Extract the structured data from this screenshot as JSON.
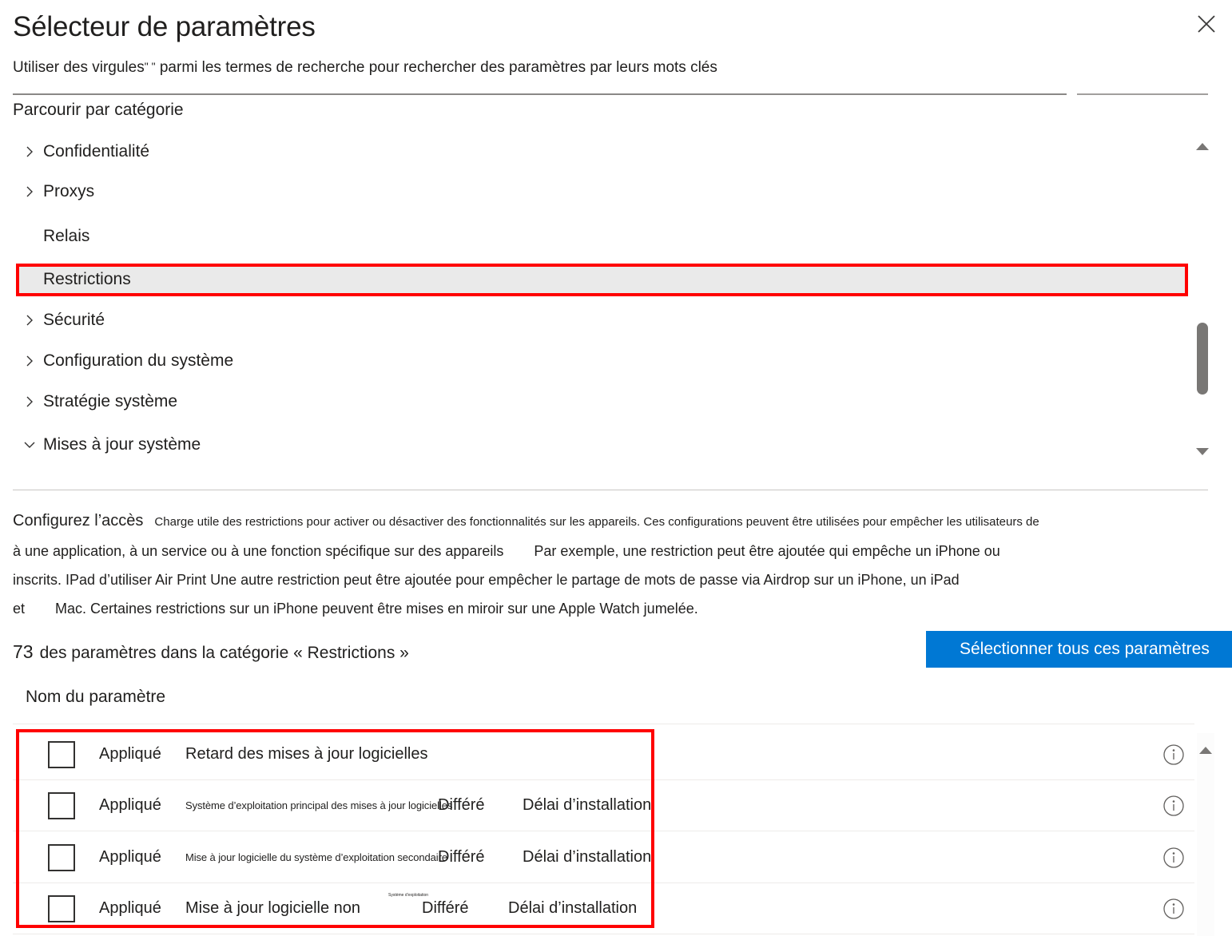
{
  "dialog": {
    "title": "Sélecteur de paramètres",
    "close_label": "Fermer",
    "close_icon": "close-icon"
  },
  "search": {
    "hint_prefix": "Utiliser des virgules",
    "hint_quote": "\" \"",
    "hint_suffix": " parmi les termes de recherche pour rechercher des paramètres par leurs mots clés",
    "value": "",
    "placeholder": ""
  },
  "browse": {
    "label": "Parcourir par catégorie",
    "items": [
      {
        "label": "Confidentialité",
        "expandable": true,
        "expanded": false,
        "selected": false,
        "icon": "chevron-right-icon"
      },
      {
        "label": "Proxys",
        "expandable": true,
        "expanded": false,
        "selected": false,
        "icon": "chevron-right-icon"
      },
      {
        "label": "Relais",
        "expandable": false,
        "expanded": false,
        "selected": false,
        "icon": ""
      },
      {
        "label": "Restrictions",
        "expandable": false,
        "expanded": false,
        "selected": true,
        "icon": ""
      },
      {
        "label": "Sécurité",
        "expandable": true,
        "expanded": false,
        "selected": false,
        "icon": "chevron-right-icon"
      },
      {
        "label": "Configuration du système",
        "expandable": true,
        "expanded": false,
        "selected": false,
        "icon": "chevron-right-icon"
      },
      {
        "label": "Stratégie système",
        "expandable": true,
        "expanded": false,
        "selected": false,
        "icon": "chevron-right-icon"
      },
      {
        "label": "Mises à jour système",
        "expandable": true,
        "expanded": true,
        "selected": false,
        "icon": "chevron-down-icon"
      }
    ],
    "scroll_up_icon": "triangle-up-icon",
    "scroll_down_icon": "triangle-down-icon"
  },
  "description": {
    "line1_a": "Configurez l’accès",
    "line1_b": "Charge utile des restrictions pour activer ou désactiver des fonctionnalités sur les appareils. Ces configurations peuvent être utilisées pour empêcher les utilisateurs de",
    "line2_a": "à une application, à un service ou à une fonction spécifique sur des appareils",
    "line2_b": "Par exemple, une restriction peut être ajoutée qui empêche un iPhone ou",
    "line3": "inscrits. IPad d’utiliser Air Print Une autre restriction peut être ajoutée pour empêcher le partage de mots de passe via Airdrop sur un iPhone, un iPad",
    "line4_a": "et",
    "line4_b": "Mac. Certaines restrictions sur un iPhone peuvent être mises en miroir sur une Apple Watch jumelée."
  },
  "results": {
    "count": "73",
    "count_text": "des paramètres dans la catégorie « Restrictions »",
    "select_all_label": "Sélectionner tous ces paramètres",
    "select_all_color": "#0078d4",
    "column_header": "Nom du paramètre",
    "scroll_up_icon": "triangle-up-icon",
    "rows": [
      {
        "checked": false,
        "applied": "Appliqué",
        "name": "Retard des mises à jour logicielles",
        "name_size": "normal",
        "state": "",
        "delay": "",
        "info_icon": "info-icon"
      },
      {
        "checked": false,
        "applied": "Appliqué",
        "name": "Système d’exploitation principal des mises à jour logicielles",
        "name_size": "tiny",
        "state": "Différé",
        "delay": "Délai d’installation",
        "info_icon": "info-icon"
      },
      {
        "checked": false,
        "applied": "Appliqué",
        "name": "Mise à jour logicielle du système d’exploitation secondaire",
        "name_size": "tiny",
        "state": "Différé",
        "delay": "Délai d’installation",
        "info_icon": "info-icon"
      },
      {
        "checked": false,
        "applied": "Appliqué",
        "name": "Mise à jour logicielle non",
        "name_size": "normal",
        "name_suffix": "Système d’exploitation",
        "state": "Différé",
        "delay": "Délai d’installation",
        "info_icon": "info-icon"
      }
    ]
  },
  "highlight_color": "#ff0000"
}
